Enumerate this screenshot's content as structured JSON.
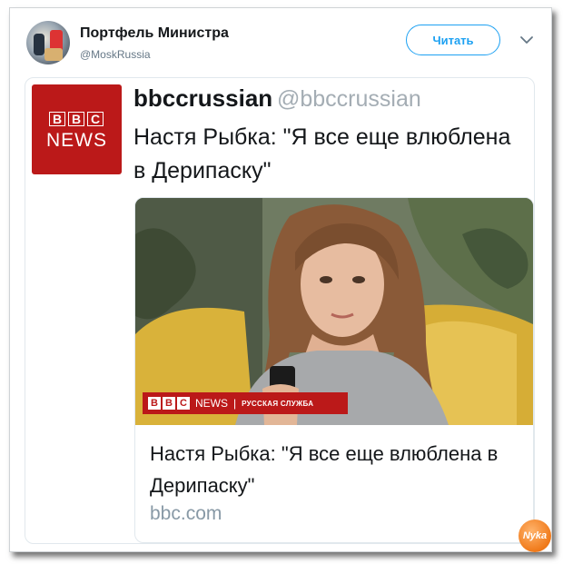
{
  "tweet": {
    "account_name": "Портфель Министра",
    "account_handle": "@MoskRussia",
    "follow_label": "Читать"
  },
  "quoted": {
    "logo_text": [
      "B",
      "B",
      "C"
    ],
    "logo_subtext": "NEWS",
    "name": "bbccrussian",
    "handle": "@bbccrussian",
    "text": "Настя Рыбка: \"Я все еще влюблена в Дерипаску\""
  },
  "link_card": {
    "image_overlay": {
      "logo_text": [
        "B",
        "B",
        "C"
      ],
      "news_label": "NEWS",
      "separator": "|",
      "service_label": "РУССКАЯ СЛУЖБА"
    },
    "title": "Настя Рыбка: \"Я все еще влюблена в Дерипаску\"",
    "domain": "bbc.com"
  },
  "watermark": "Nyka",
  "colors": {
    "follow_accent": "#1da1f2",
    "bbc_red": "#bb1919",
    "muted": "#8899a6"
  },
  "icons": [
    "avatar",
    "chevron-down-icon",
    "bbc-logo",
    "watermark-logo"
  ]
}
